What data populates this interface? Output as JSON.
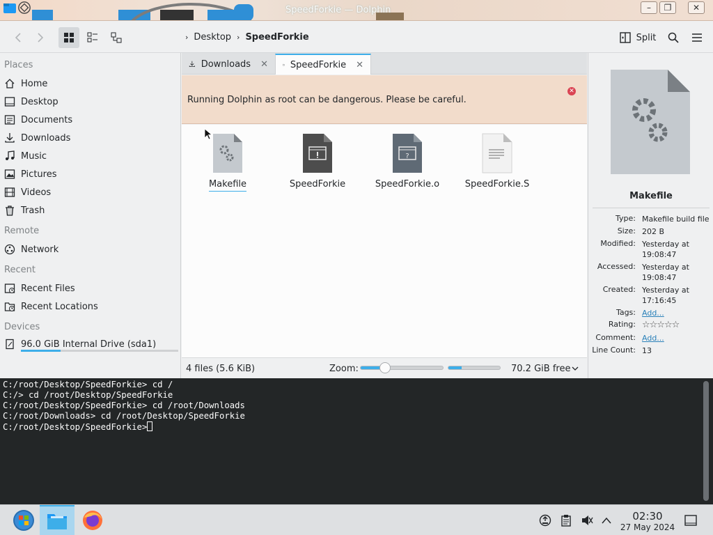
{
  "window": {
    "title": "SpeedForkie — Dolphin"
  },
  "toolbar": {
    "split_label": "Split",
    "breadcrumb": [
      "Desktop",
      "SpeedForkie"
    ]
  },
  "places": {
    "sections": [
      {
        "title": "Places",
        "items": [
          "Home",
          "Desktop",
          "Documents",
          "Downloads",
          "Music",
          "Pictures",
          "Videos",
          "Trash"
        ]
      },
      {
        "title": "Remote",
        "items": [
          "Network"
        ]
      },
      {
        "title": "Recent",
        "items": [
          "Recent Files",
          "Recent Locations"
        ]
      },
      {
        "title": "Devices",
        "items": [
          "96.0 GiB Internal Drive (sda1)"
        ]
      }
    ],
    "drive_usage_fraction": 0.25
  },
  "tabs": [
    {
      "label": "Downloads",
      "active": false
    },
    {
      "label": "SpeedForkie",
      "active": true
    }
  ],
  "warning": {
    "message": "Running Dolphin as root can be dangerous. Please be careful."
  },
  "files": [
    {
      "name": "Makefile",
      "icon": "makefile-gear-icon",
      "selected": true
    },
    {
      "name": "SpeedForkie",
      "icon": "executable-icon",
      "selected": false
    },
    {
      "name": "SpeedForkie.o",
      "icon": "unknown-file-icon",
      "selected": false
    },
    {
      "name": "SpeedForkie.S",
      "icon": "text-file-icon",
      "selected": false
    }
  ],
  "status": {
    "summary": "4 files (5.6 KiB)",
    "zoom_label": "Zoom:",
    "zoom_fraction": 0.3,
    "space_used_fraction": 0.25,
    "free_space": "70.2 GiB free"
  },
  "info": {
    "title": "Makefile",
    "rows": [
      {
        "key": "Type:",
        "value": "Makefile build file"
      },
      {
        "key": "Size:",
        "value": "202 B"
      },
      {
        "key": "Modified:",
        "value": "Yesterday at 19:08:47"
      },
      {
        "key": "Accessed:",
        "value": "Yesterday at 19:08:47"
      },
      {
        "key": "Created:",
        "value": "Yesterday at 17:16:45"
      },
      {
        "key": "Tags:",
        "value": "Add..."
      },
      {
        "key": "Rating:",
        "value": "☆☆☆☆☆"
      },
      {
        "key": "Comment:",
        "value": "Add..."
      },
      {
        "key": "Line Count:",
        "value": "13"
      }
    ]
  },
  "terminal": {
    "lines": [
      "C:/root/Desktop/SpeedForkie> cd /",
      "C:/> cd /root/Desktop/SpeedForkie",
      "C:/root/Desktop/SpeedForkie> cd /root/Downloads",
      "C:/root/Downloads> cd /root/Desktop/SpeedForkie",
      "C:/root/Desktop/SpeedForkie>"
    ]
  },
  "taskbar": {
    "time": "02:30",
    "date": "27 May 2024"
  },
  "colors": {
    "accent": "#3daee9",
    "warning_bg": "#f2dccb",
    "close_red": "#da4453",
    "terminal_bg": "#232627"
  }
}
